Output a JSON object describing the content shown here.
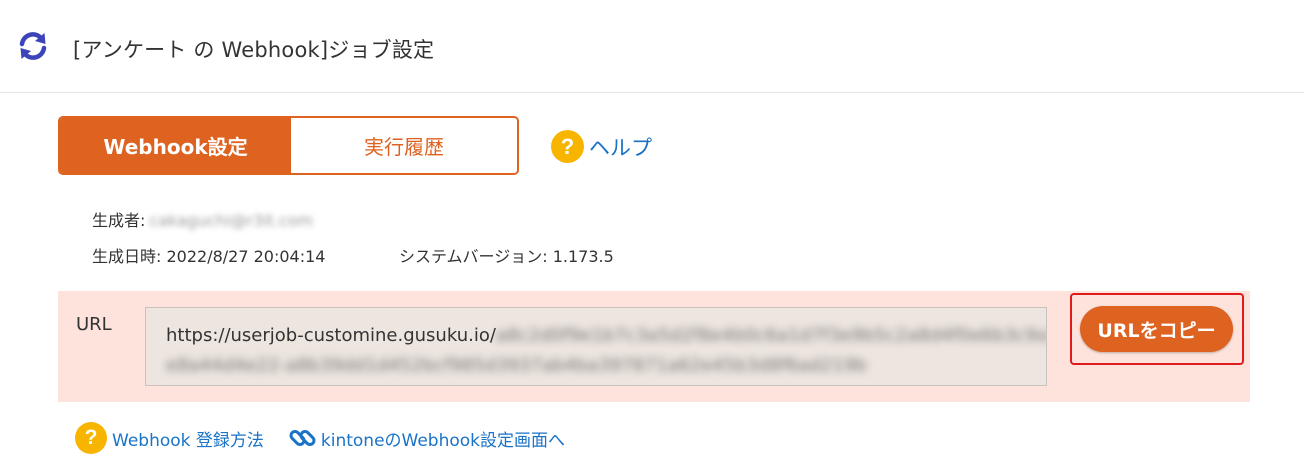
{
  "header": {
    "icon": "refresh-icon",
    "title": "[アンケート の Webhook]ジョブ設定"
  },
  "tabs": [
    {
      "label": "Webhook設定",
      "active": true
    },
    {
      "label": "実行履歴",
      "active": false
    }
  ],
  "help": {
    "icon": "help-question-icon",
    "label": "ヘルプ"
  },
  "meta": {
    "creator_label": "生成者:",
    "creator_value": "cakaguchi@r3it.com",
    "created_label": "生成日時:",
    "created_value": "2022/8/27 20:04:14",
    "version_label": "システムバージョン:",
    "version_value": "1.173.5"
  },
  "url_panel": {
    "label": "URL",
    "url_visible": "https://userjob-customine.gusuku.io/",
    "url_hidden_1": "a8c2d0f9e1b7c3a5d2f8e4b0c6a1d7f3e9b5c2a8d4f0e6b3c9a1",
    "url_hidden_2": "e8a44d4e22-a8b39dd1d452bcf985d3937ab4ba397871a62e45b3d8f6ad219b",
    "copy_button": "URLをコピー"
  },
  "links": [
    {
      "icon": "help-question-icon",
      "label": "Webhook 登録方法"
    },
    {
      "icon": "link-chain-icon",
      "label": "kintoneのWebhook設定画面へ"
    }
  ],
  "colors": {
    "accent": "#de6220",
    "link": "#1a73c7",
    "help_icon": "#f7b500",
    "url_panel_bg": "#fde3dc",
    "highlight_frame": "#e01b1b"
  }
}
